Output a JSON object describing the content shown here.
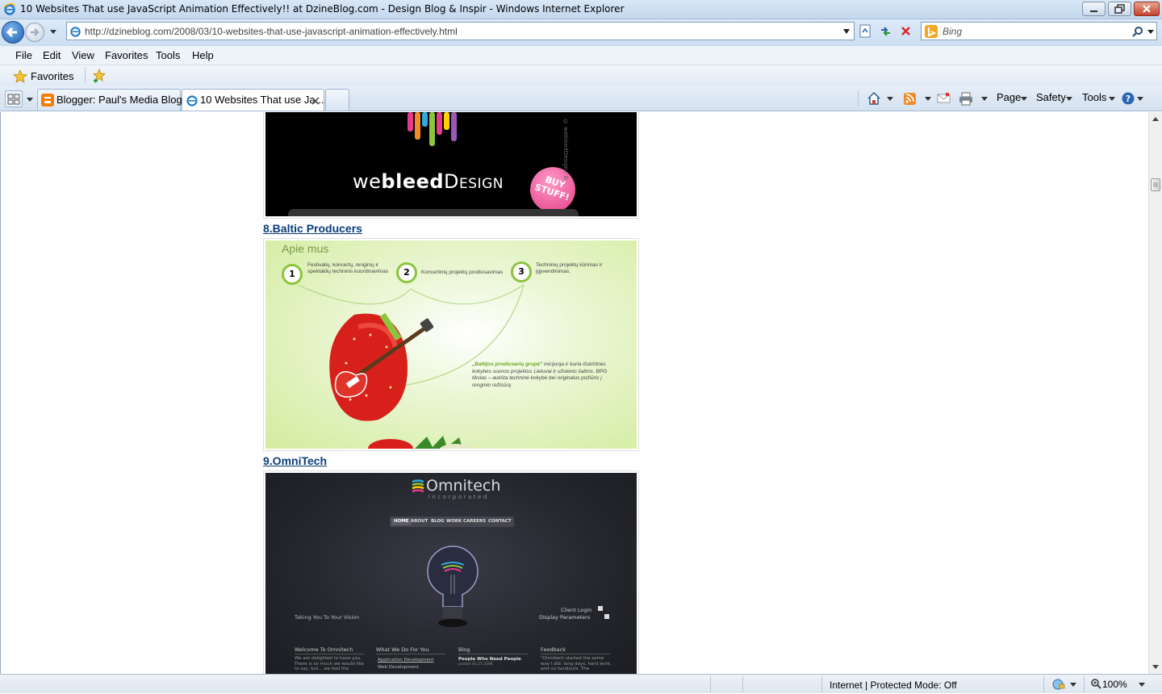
{
  "window": {
    "title": "10 Websites That use JavaScript Animation Effectively!! at DzineBlog.com - Design Blog & Inspir - Windows Internet Explorer"
  },
  "address_bar": {
    "url": "http://dzineblog.com/2008/03/10-websites-that-use-javascript-animation-effectively.html"
  },
  "search_bar": {
    "placeholder": "Bing"
  },
  "menu": {
    "items": [
      "File",
      "Edit",
      "View",
      "Favorites",
      "Tools",
      "Help"
    ]
  },
  "favorites_bar": {
    "label": "Favorites"
  },
  "tabs": [
    {
      "label": "Blogger: Paul's Media Blog..."
    },
    {
      "label": "10 Websites That use Ja..."
    }
  ],
  "command_bar": {
    "page": "Page",
    "safety": "Safety",
    "tools": "Tools"
  },
  "content": {
    "shot7": {
      "brand": "webleedDesign",
      "brand_we": "we",
      "brand_bleed": "bleed",
      "brand_design": "Design",
      "badge": "BUY STUFF!",
      "vertical_text": "© webleedDesign / B"
    },
    "item8": {
      "heading": "8.Baltic Producers",
      "shot_title": "Apie mus",
      "steps": [
        {
          "num": "1",
          "text": "Festivalių, koncertų, renginių ir spektaklių techninis koordinavimas"
        },
        {
          "num": "2",
          "text": "Koncertinių projektų prodiusavimas"
        },
        {
          "num": "3",
          "text": "Techninių projektų kūrimas ir įgyvendinimas."
        }
      ],
      "quote_lead": "„Baltijos prodiuserių grupė\"",
      "quote_rest": "inicijuoja ir kuria išskirtinės kokybės scenos projektus Lietuvai ir užsienio šalims. BPG tikslas – aukšta techninė kokybė bei originalus požiūris į renginio režisūrą"
    },
    "item9": {
      "heading": "9.OmniTech",
      "logo": "Omnitech",
      "logo_sub": "incorporated",
      "nav": [
        "HOME",
        "ABOUT",
        "BLOG",
        "WORK",
        "CAREERS",
        "CONTACT"
      ],
      "tagline": "Taking You To Your Vision",
      "client_login": "Client Login",
      "display_params": "Display Parameters",
      "columns": [
        {
          "title": "Welcome To Omnitech",
          "body": "We are delighted to have you. There is so much we would like to say, but... we feel the"
        },
        {
          "title": "What We Do For You",
          "items": [
            "Application Development",
            "Web Development"
          ]
        },
        {
          "title": "Blog",
          "post": "People Who Need People",
          "date": "posted 02.27.2008"
        },
        {
          "title": "Feedback",
          "body": "\"Omnitech started the same way I did: long days, hard work, and no handouts. The"
        }
      ]
    }
  },
  "status_bar": {
    "zone": "Internet | Protected Mode: Off",
    "zoom": "100%"
  },
  "colors": {
    "link": "#0a3d7a",
    "omni_bg": "#24262c",
    "baltic_bg": "#e4f3c4",
    "webleed_bg": "#000000"
  }
}
